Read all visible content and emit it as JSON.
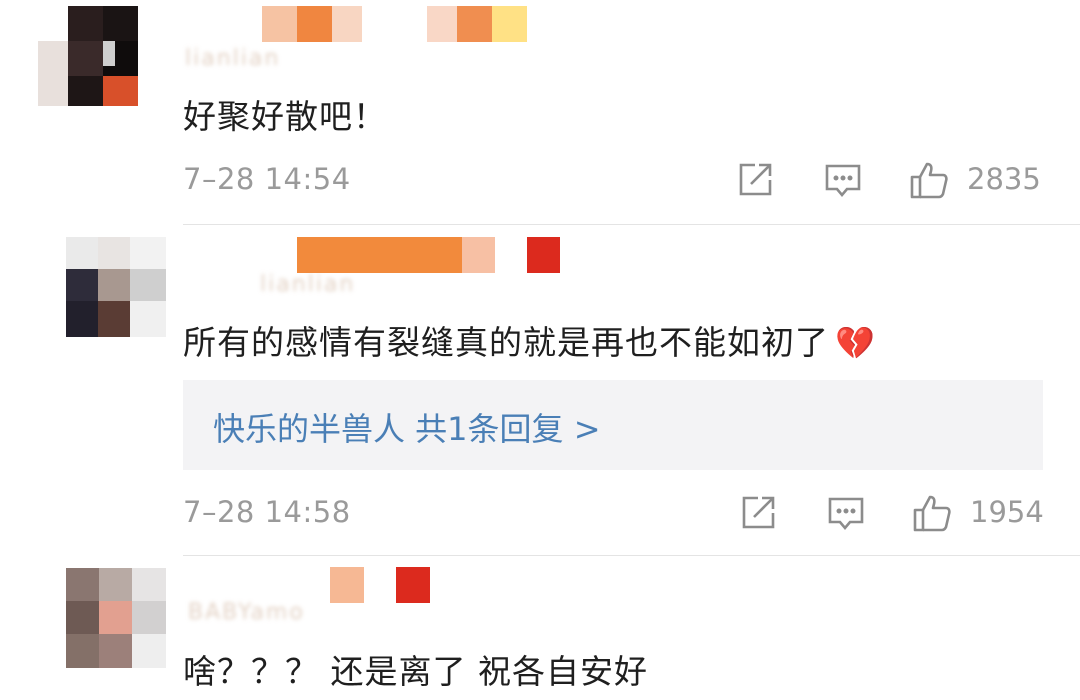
{
  "comments": [
    {
      "username_blurred": "lianlian",
      "text": "好聚好散吧！",
      "time": "7–28 14:54",
      "likes": "2835"
    },
    {
      "username_blurred": "lianlian",
      "text": "所有的感情有裂缝真的就是再也不能如初了",
      "emoji": "💔",
      "reply_summary": "快乐的半兽人  共1条回复 >",
      "time": "7–28 14:58",
      "likes": "1954"
    },
    {
      "username_blurred": "BABYamo",
      "text": "啥？？？ 还是离了 祝各自安好"
    }
  ],
  "icons": [
    "share-icon",
    "comment-icon",
    "like-icon"
  ],
  "colors": {
    "reply_link": "#4a7fb6",
    "meta_gray": "#9a9a9a",
    "reply_bg": "#f3f3f5"
  }
}
